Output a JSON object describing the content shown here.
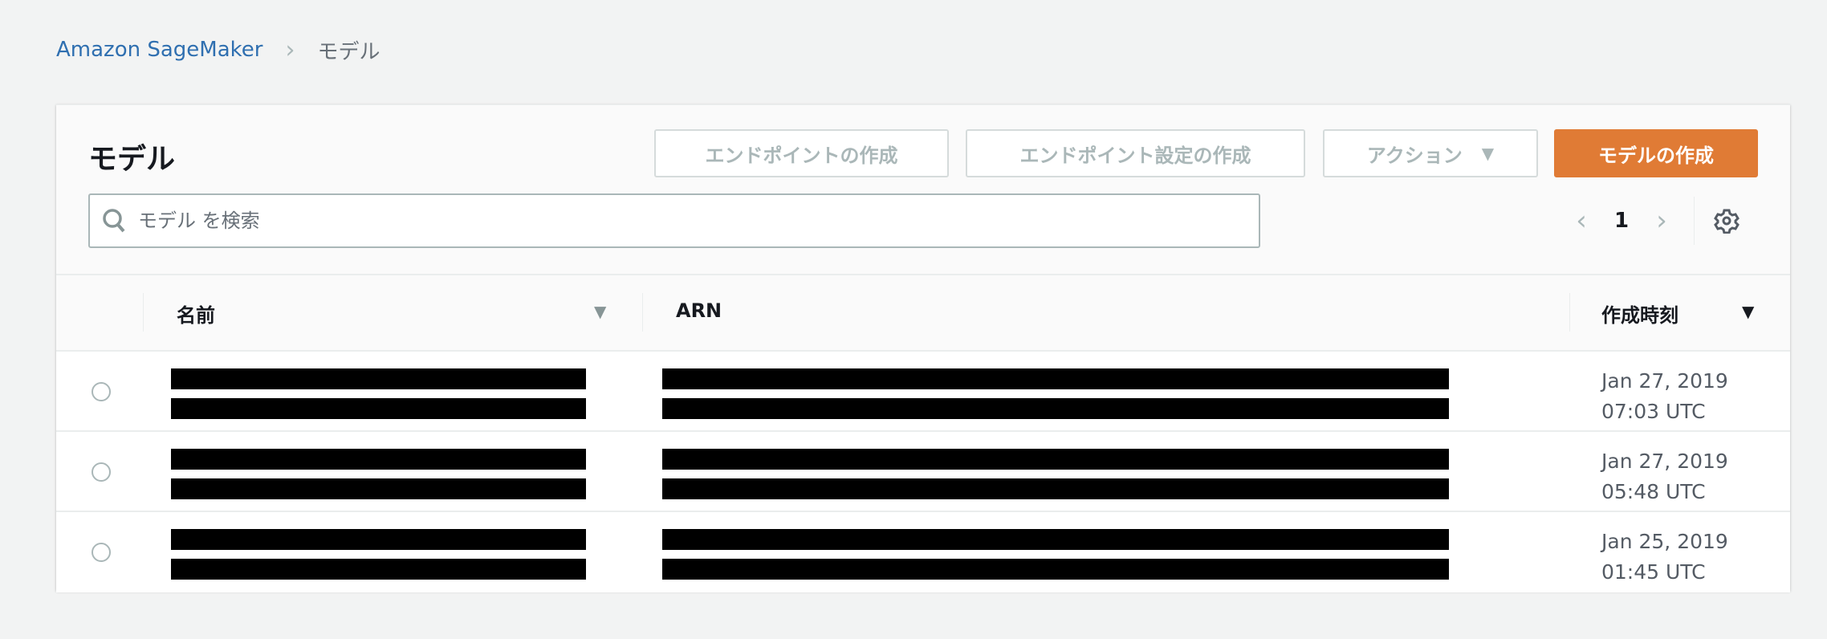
{
  "breadcrumb": {
    "root": "Amazon SageMaker",
    "current": "モデル"
  },
  "panel": {
    "title": "モデル",
    "buttons": {
      "create_endpoint": "エンドポイントの作成",
      "create_endpoint_config": "エンドポイント設定の作成",
      "actions": "アクション",
      "create_model": "モデルの作成"
    },
    "search": {
      "placeholder": "モデル を検索",
      "value": ""
    },
    "pagination": {
      "page": "1"
    }
  },
  "table": {
    "columns": {
      "name": "名前",
      "arn": "ARN",
      "created": "作成時刻"
    },
    "rows": [
      {
        "date": "Jan 27, 2019",
        "time": "07:03 UTC"
      },
      {
        "date": "Jan 27, 2019",
        "time": "05:48 UTC"
      },
      {
        "date": "Jan 25, 2019",
        "time": "01:45 UTC"
      }
    ]
  },
  "colors": {
    "primary": "#e07b35",
    "link": "#2f6fb0"
  }
}
